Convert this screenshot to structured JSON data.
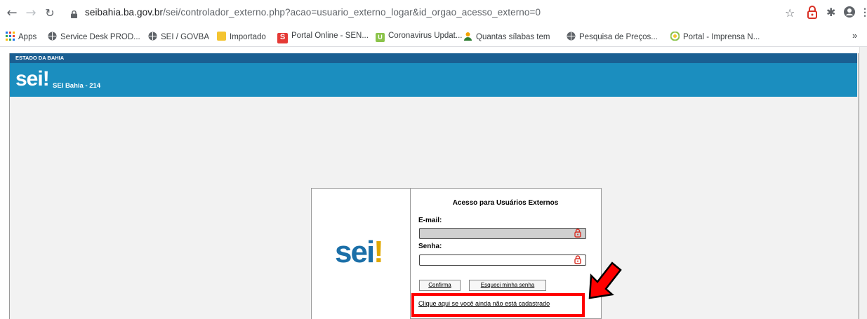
{
  "browser": {
    "url_host": "seibahia.ba.gov.br",
    "url_path": "/sei/controlador_externo.php?acao=usuario_externo_logar&id_orgao_acesso_externo=0",
    "bookmarks": [
      {
        "label": "Apps",
        "icon": "apps-grid-icon",
        "color": "#1a73e8"
      },
      {
        "label": "Service Desk PROD...",
        "icon": "globe-icon",
        "color": "#5f6368"
      },
      {
        "label": "SEI / GOVBA",
        "icon": "globe-icon",
        "color": "#5f6368"
      },
      {
        "label": "Importado",
        "icon": "folder-icon",
        "color": "#f4c430"
      },
      {
        "label": "Portal Online - SEN...",
        "icon": "senac-s-icon",
        "color": "#e53935"
      },
      {
        "label": "Coronavirus Updat...",
        "icon": "u-icon",
        "color": "#8bc34a"
      },
      {
        "label": "Quantas sílabas tem",
        "icon": "person-icon",
        "color": "#f4a300"
      },
      {
        "label": "Pesquisa de Preços...",
        "icon": "globe-icon",
        "color": "#5f6368"
      },
      {
        "label": "Portal - Imprensa N...",
        "icon": "seal-icon",
        "color": "#8bc34a"
      }
    ],
    "more_bookmarks": "»"
  },
  "header": {
    "estado": "ESTADO DA BAHIA",
    "logo": "sei",
    "logo_mark": "!",
    "title": "SEI Bahia - 214"
  },
  "login": {
    "logo": "sei",
    "logo_mark": "!",
    "title": "Acesso para Usuários Externos",
    "email_label": "E-mail:",
    "password_label": "Senha:",
    "confirm_button": "Confirma",
    "forgot_button": "Esqueci minha senha",
    "register_link": "Clique aqui se você ainda não está cadastrado"
  },
  "colors": {
    "header_dark": "#1a5f92",
    "header_light": "#1b8ebf",
    "highlight": "#ff0000"
  }
}
